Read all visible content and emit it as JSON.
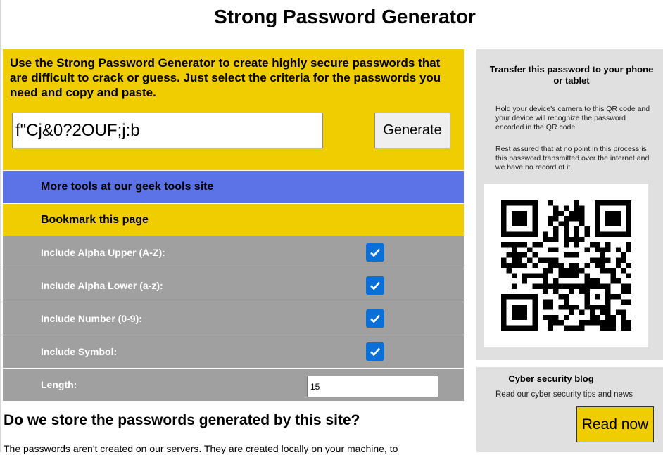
{
  "title": "Strong Password Generator",
  "intro": {
    "text": "Use the Strong Password Generator to create highly secure passwords that are difficult to crack or guess. Just select the criteria for the passwords you need and copy and paste.",
    "password_value": "f\"Cj&0?2OUF;j:b",
    "generate_label": "Generate"
  },
  "links": {
    "more_tools": "More tools at our geek tools site",
    "bookmark": "Bookmark this page"
  },
  "options": [
    {
      "label": "Include Alpha Upper (A-Z):",
      "checked": true
    },
    {
      "label": "Include Alpha Lower (a-z):",
      "checked": true
    },
    {
      "label": "Include Number (0-9):",
      "checked": true
    },
    {
      "label": "Include Symbol:",
      "checked": true
    }
  ],
  "length": {
    "label": "Length:",
    "value": "15"
  },
  "sidebar": {
    "qr_title": "Transfer this password to your phone or tablet",
    "qr_text_1": "Hold your device's camera to this QR code and your device will recognize the password encoded in the QR code.",
    "qr_text_2": "Rest assured that at no point in this process is this password transmitted over the internet and we have no record of it.",
    "blog_title": "Cyber security blog",
    "blog_text": "Read our cyber security tips and news",
    "read_now_label": "Read now"
  },
  "faq": {
    "heading": "Do we store the passwords generated by this site?",
    "text": "The passwords aren't created on our servers. They are created locally on your machine, to"
  },
  "colors": {
    "yellow": "#f0cd00",
    "blue": "#5b73e6",
    "grey": "#a0a0a0",
    "checkbox": "#0b6fd8",
    "side_panel": "#e0e0e0"
  },
  "icons": {
    "checkbox": "checkmark-icon",
    "qr": "qr-code-image"
  }
}
